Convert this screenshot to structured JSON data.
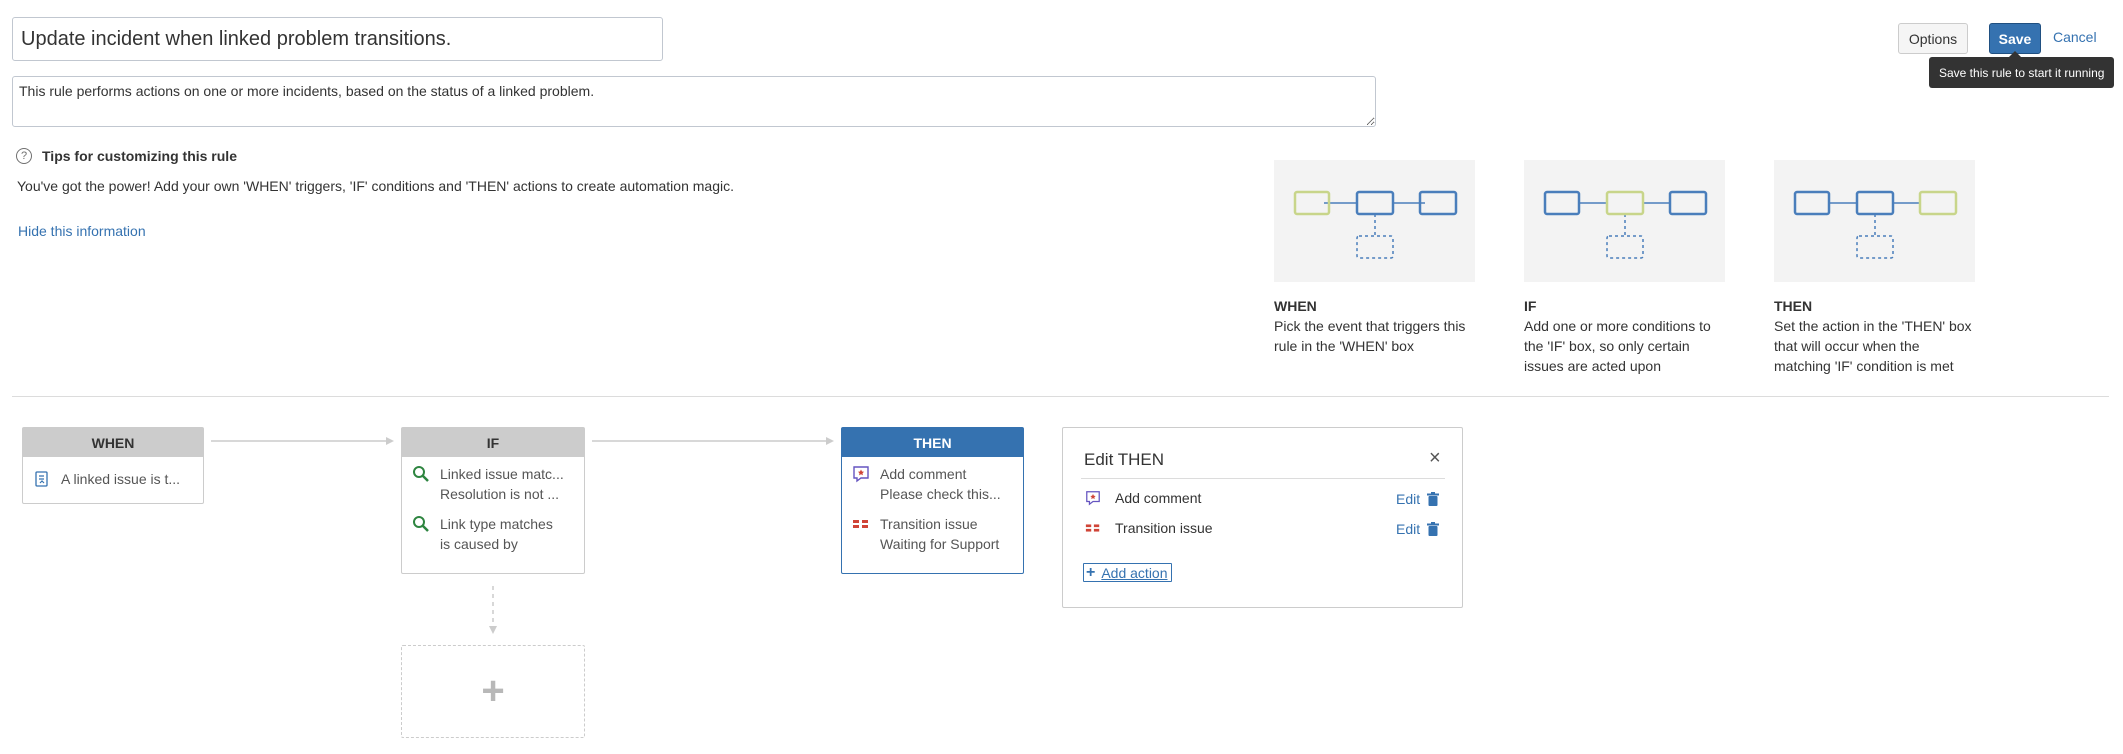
{
  "rule": {
    "name": "Update incident when linked problem transitions.",
    "description": "This rule performs actions on one or more incidents, based on the status of a linked problem."
  },
  "toolbar": {
    "options_label": "Options",
    "save_label": "Save",
    "cancel_label": "Cancel",
    "save_tooltip": "Save this rule to start it running"
  },
  "tips": {
    "title": "Tips for customizing this rule",
    "body": "You've got the power! Add your own 'WHEN' triggers, 'IF' conditions and 'THEN' actions to create automation magic.",
    "hide_link": "Hide this information",
    "help_glyph": "?",
    "diagrams": [
      {
        "title": "WHEN",
        "desc": "Pick the event that triggers this rule in the 'WHEN' box",
        "highlight": "first"
      },
      {
        "title": "IF",
        "desc": "Add one or more conditions to the 'IF' box, so only certain issues are acted upon",
        "highlight": "middle"
      },
      {
        "title": "THEN",
        "desc": "Set the action in the 'THEN' box that will occur when the matching 'IF' condition is met",
        "highlight": "last"
      }
    ]
  },
  "colors": {
    "accent": "#3572b0",
    "highlight_box": "#c8d58a",
    "box_outline": "#4a7ebb",
    "search_icon": "#2e8540",
    "transition_icon": "#d04437",
    "comment_icon": "#6554c0"
  },
  "flow": {
    "when": {
      "header": "WHEN",
      "items": [
        {
          "icon": "issue-link-icon",
          "line1": "A linked issue is t..."
        }
      ]
    },
    "if": {
      "header": "IF",
      "items": [
        {
          "icon": "search-icon",
          "line1": "Linked issue matc...",
          "line2": "Resolution is not ..."
        },
        {
          "icon": "search-icon",
          "line1": "Link type matches",
          "line2": "is caused by"
        }
      ]
    },
    "then": {
      "header": "THEN",
      "items": [
        {
          "icon": "comment-icon",
          "line1": "Add comment",
          "line2": "Please check this..."
        },
        {
          "icon": "transition-icon",
          "line1": "Transition issue",
          "line2": "Waiting for Support"
        }
      ]
    },
    "add_condition_glyph": "+"
  },
  "edit_then": {
    "title": "Edit THEN",
    "close_glyph": "×",
    "actions": [
      {
        "icon": "comment-icon",
        "label": "Add comment",
        "edit_label": "Edit"
      },
      {
        "icon": "transition-icon",
        "label": "Transition issue",
        "edit_label": "Edit"
      }
    ],
    "add_action_glyph": "+",
    "add_action_label": "Add action"
  }
}
